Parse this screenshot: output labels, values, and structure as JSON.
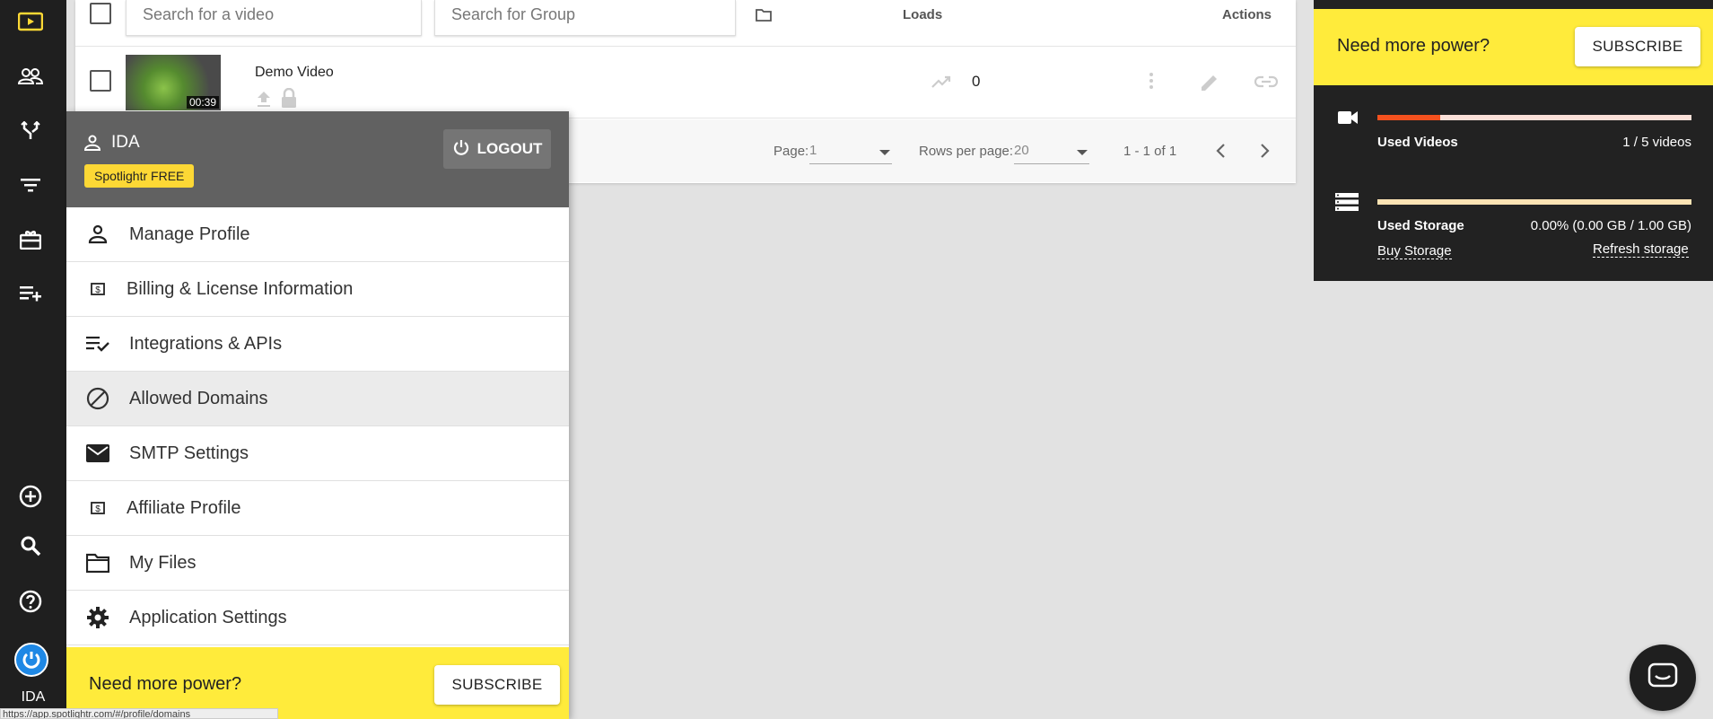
{
  "rail": {
    "icons": [
      "videos-icon",
      "users-icon",
      "funnel-icon",
      "filter-icon",
      "gift-icon",
      "playlist-add-icon"
    ],
    "bottom_icons": [
      "add-circle-icon",
      "search-icon",
      "help-icon"
    ],
    "user_label": "IDA"
  },
  "table": {
    "search_video_placeholder": "Search for a video",
    "search_group_placeholder": "Search for Group",
    "col_loads": "Loads",
    "col_actions": "Actions",
    "rows": [
      {
        "title": "Demo Video",
        "duration": "00:39",
        "loads": "0"
      }
    ],
    "pagination": {
      "page_label": "Page:",
      "page_value": "1",
      "rows_label": "Rows per page:",
      "rows_value": "20",
      "range": "1 - 1 of 1"
    }
  },
  "usage": {
    "banner_text": "Need more power?",
    "subscribe_label": "SUBSCRIBE",
    "videos_label": "Used Videos",
    "videos_value": "1 / 5 videos",
    "videos_fraction": 0.2,
    "storage_label": "Used Storage",
    "storage_value": "0.00% (0.00 GB / 1.00 GB)",
    "storage_fraction": 0.0,
    "buy_storage": "Buy Storage",
    "refresh_storage": "Refresh storage",
    "colors": {
      "accent": "#ffeb3b",
      "bar_fill": "#f4511e"
    }
  },
  "menu": {
    "user": "IDA",
    "plan": "Spotlightr FREE",
    "logout_label": "LOGOUT",
    "items": [
      {
        "label": "Manage Profile",
        "icon": "person-icon"
      },
      {
        "label": "Billing & License Information",
        "icon": "billing-icon"
      },
      {
        "label": "Integrations & APIs",
        "icon": "playlist-check-icon"
      },
      {
        "label": "Allowed Domains",
        "icon": "block-icon"
      },
      {
        "label": "SMTP Settings",
        "icon": "mail-icon"
      },
      {
        "label": "Affiliate Profile",
        "icon": "money-icon"
      },
      {
        "label": "My Files",
        "icon": "folder-icon"
      },
      {
        "label": "Application Settings",
        "icon": "gear-icon"
      }
    ],
    "banner_text": "Need more power?",
    "subscribe_label": "SUBSCRIBE"
  },
  "status_url": "https://app.spotlightr.com/#/profile/domains"
}
